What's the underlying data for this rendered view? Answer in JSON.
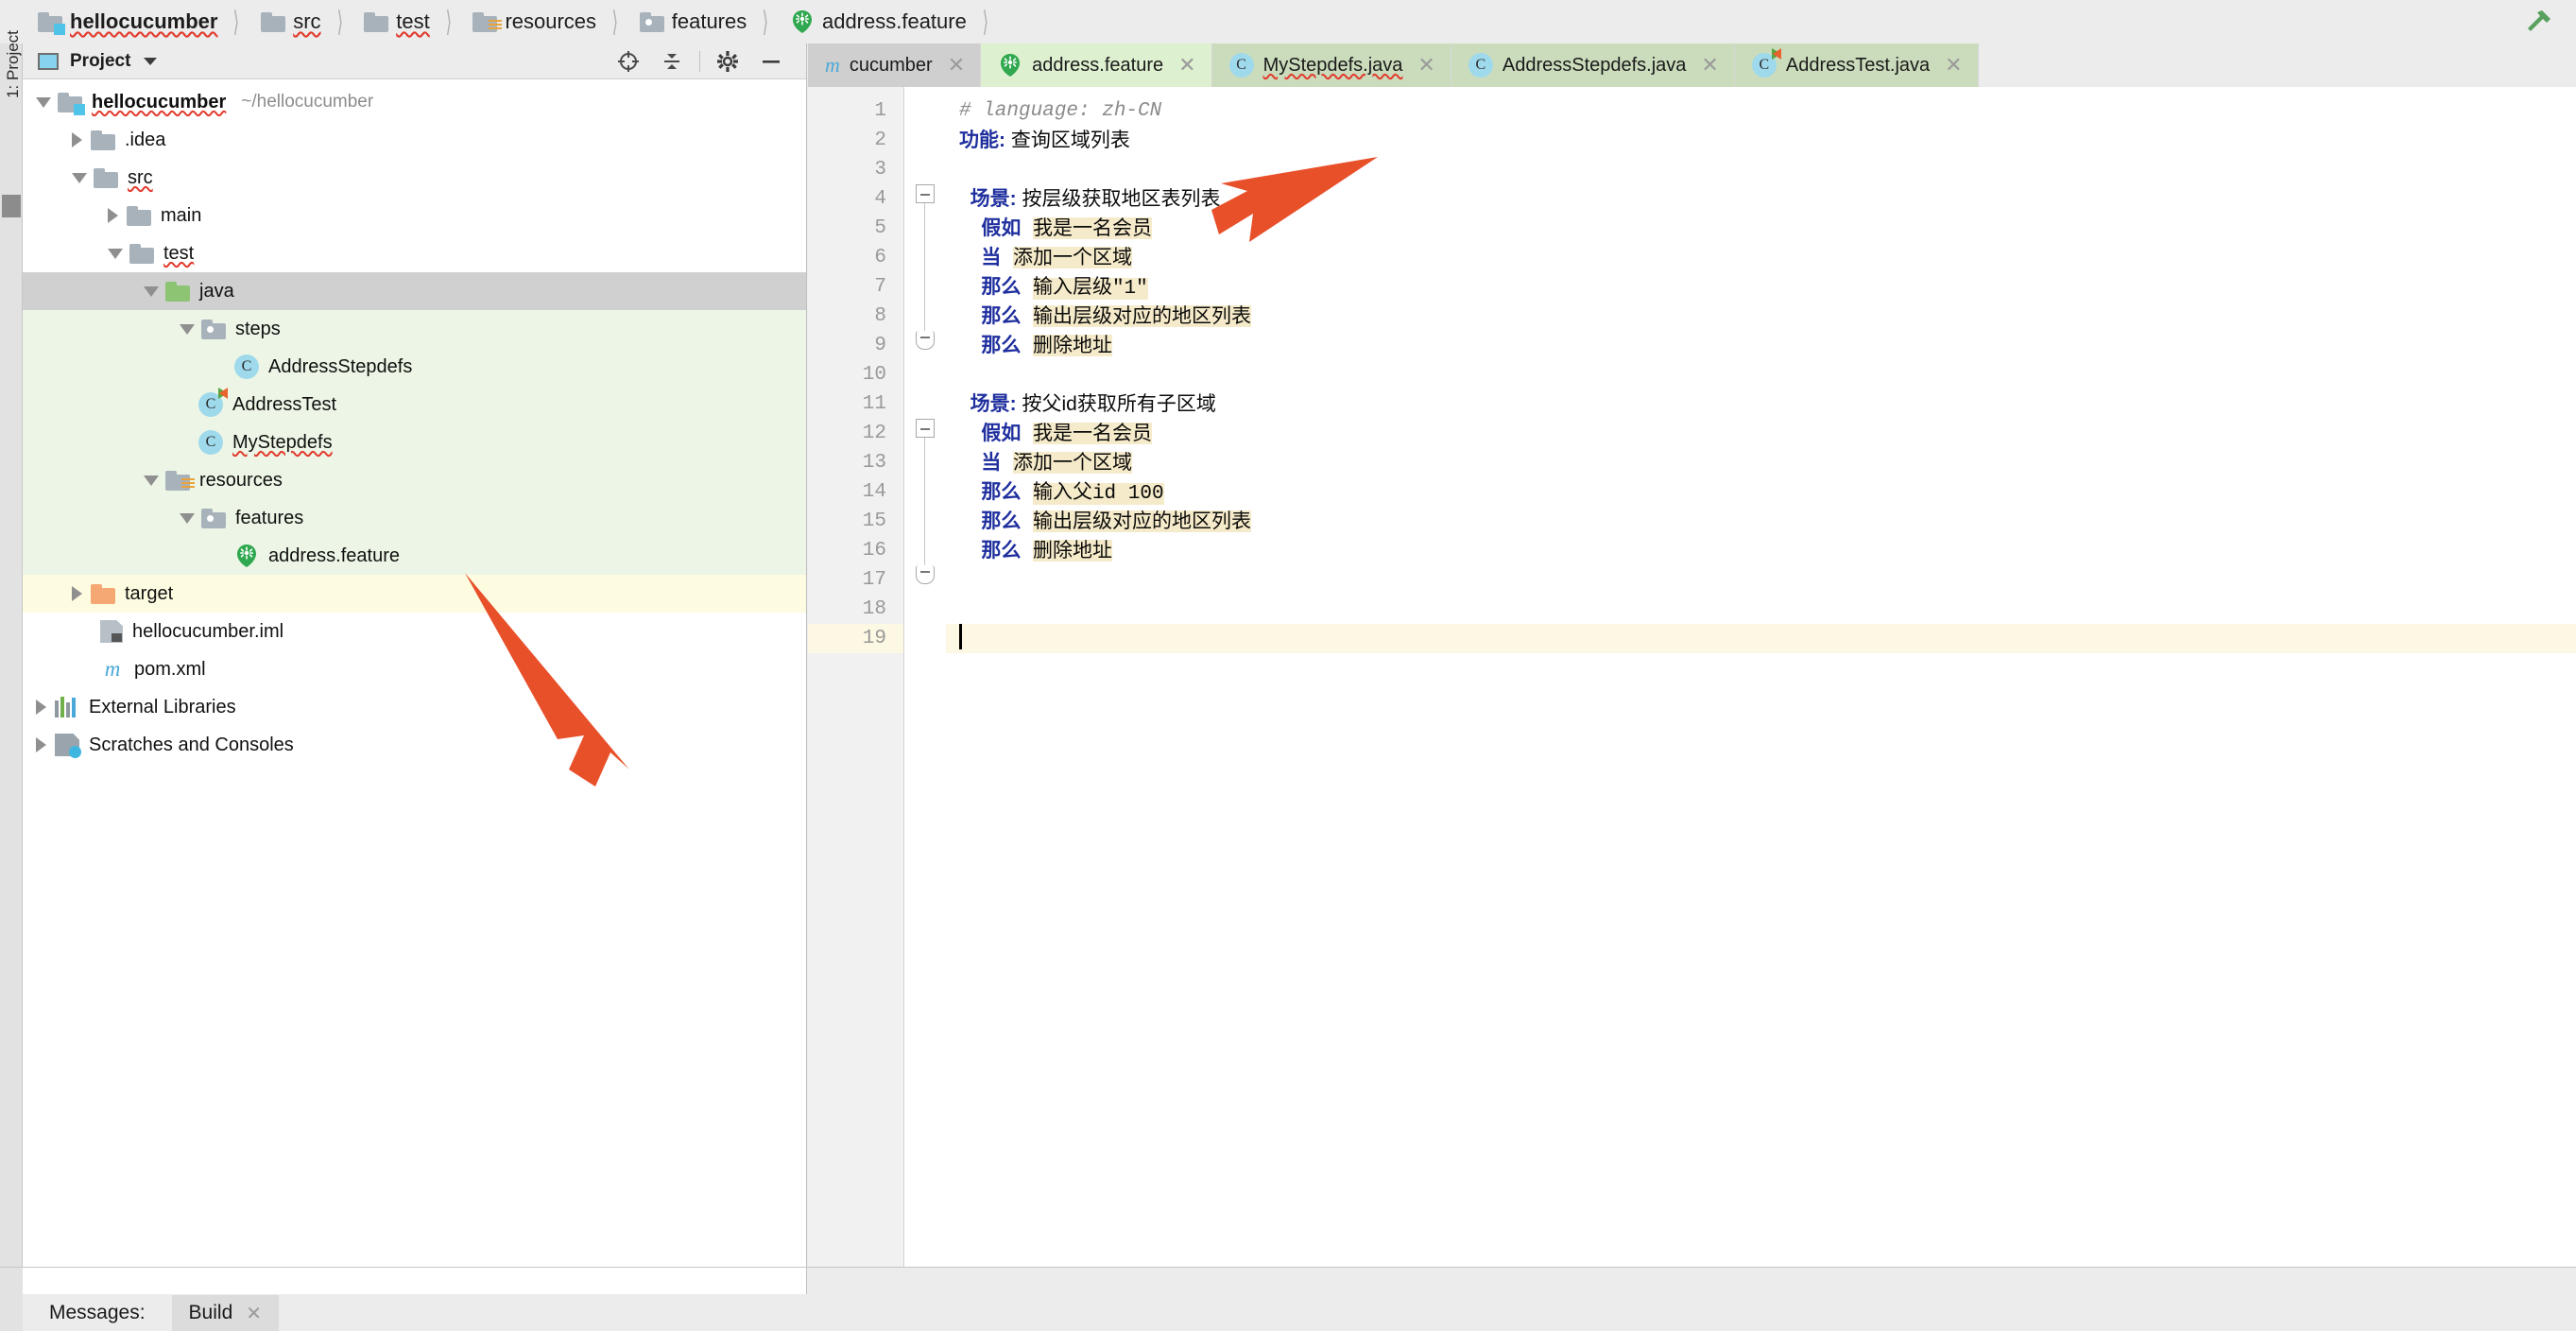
{
  "breadcrumb": {
    "items": [
      {
        "label": "hellocucumber",
        "icon": "module-folder-icon"
      },
      {
        "label": "src",
        "icon": "folder-icon"
      },
      {
        "label": "test",
        "icon": "folder-icon"
      },
      {
        "label": "resources",
        "icon": "resources-folder-icon"
      },
      {
        "label": "features",
        "icon": "package-folder-icon"
      },
      {
        "label": "address.feature",
        "icon": "cucumber-icon"
      }
    ]
  },
  "toolwindow_strip": {
    "project_label": "1: Project"
  },
  "project_panel": {
    "title": "Project",
    "actions": [
      "locate-icon",
      "collapse-all-icon",
      "settings-icon",
      "hide-icon"
    ],
    "tree": [
      {
        "label": "hellocucumber",
        "path": "~/hellocucumber",
        "icon": "module-folder-icon",
        "depth": 0,
        "arrow": "open",
        "bold": true,
        "bg": "none",
        "typo": true
      },
      {
        "label": ".idea",
        "icon": "folder-icon",
        "depth": 1,
        "arrow": "closed",
        "bg": "none"
      },
      {
        "label": "src",
        "icon": "folder-icon",
        "depth": 1,
        "arrow": "open",
        "bg": "none",
        "typo": true
      },
      {
        "label": "main",
        "icon": "folder-icon",
        "depth": 2,
        "arrow": "closed",
        "bg": "none"
      },
      {
        "label": "test",
        "icon": "folder-icon",
        "depth": 2,
        "arrow": "open",
        "bg": "none",
        "typo": true
      },
      {
        "label": "java",
        "icon": "source-folder-icon",
        "depth": 3,
        "arrow": "open",
        "bg": "selected",
        "typo": true
      },
      {
        "label": "steps",
        "icon": "package-folder-icon",
        "depth": 4,
        "arrow": "open",
        "bg": "green"
      },
      {
        "label": "AddressStepdefs",
        "icon": "java-class-icon",
        "depth": 5,
        "arrow": "none",
        "bg": "green"
      },
      {
        "label": "AddressTest",
        "icon": "java-class-runnable-icon",
        "depth": 4,
        "arrow": "none",
        "bg": "green"
      },
      {
        "label": "MyStepdefs",
        "icon": "java-class-icon",
        "depth": 4,
        "arrow": "none",
        "bg": "green",
        "typo": true
      },
      {
        "label": "resources",
        "icon": "resources-folder-icon",
        "depth": 3,
        "arrow": "open",
        "bg": "green"
      },
      {
        "label": "features",
        "icon": "package-folder-icon",
        "depth": 4,
        "arrow": "open",
        "bg": "green"
      },
      {
        "label": "address.feature",
        "icon": "cucumber-icon",
        "depth": 5,
        "arrow": "none",
        "bg": "green"
      },
      {
        "label": "target",
        "icon": "excluded-folder-icon",
        "depth": 1,
        "arrow": "closed",
        "bg": "yellow"
      },
      {
        "label": "hellocucumber.iml",
        "icon": "iml-file-icon",
        "depth": 1,
        "arrow": "none",
        "bg": "none"
      },
      {
        "label": "pom.xml",
        "icon": "maven-icon",
        "depth": 1,
        "arrow": "none",
        "bg": "none"
      },
      {
        "label": "External Libraries",
        "icon": "libraries-icon",
        "depth": 0,
        "arrow": "closed",
        "bg": "none"
      },
      {
        "label": "Scratches and Consoles",
        "icon": "scratches-icon",
        "depth": 0,
        "arrow": "closed",
        "bg": "none"
      }
    ]
  },
  "editor": {
    "tabs": [
      {
        "label": "cucumber",
        "icon": "maven-icon",
        "state": "inactive-gray",
        "closable": true
      },
      {
        "label": "address.feature",
        "icon": "cucumber-icon",
        "state": "active",
        "closable": true
      },
      {
        "label": "MyStepdefs.java",
        "icon": "java-class-icon",
        "state": "green",
        "closable": true,
        "typo": true
      },
      {
        "label": "AddressStepdefs.java",
        "icon": "java-class-icon",
        "state": "green",
        "closable": true
      },
      {
        "label": "AddressTest.java",
        "icon": "java-class-runnable-icon",
        "state": "green",
        "closable": true
      }
    ],
    "line_numbers": [
      "1",
      "2",
      "3",
      "4",
      "5",
      "6",
      "7",
      "8",
      "9",
      "10",
      "11",
      "12",
      "13",
      "14",
      "15",
      "16",
      "17",
      "18",
      "19"
    ],
    "caret_line": 19,
    "lines": [
      {
        "n": 1,
        "segments": [
          {
            "t": "# language: zh-CN",
            "style": "comment"
          }
        ]
      },
      {
        "n": 2,
        "segments": [
          {
            "t": "功能:",
            "style": "keyword"
          },
          {
            "t": " 查询区域列表",
            "style": "plain"
          }
        ]
      },
      {
        "n": 3,
        "segments": []
      },
      {
        "n": 4,
        "segments": [
          {
            "t": "  场景:",
            "style": "keyword"
          },
          {
            "t": " 按层级获取地区表列表",
            "style": "plain"
          }
        ]
      },
      {
        "n": 5,
        "segments": [
          {
            "t": "    假如",
            "style": "keyword"
          },
          {
            "t": " ",
            "style": "plain"
          },
          {
            "t": "我是一名会员",
            "style": "step"
          }
        ]
      },
      {
        "n": 6,
        "segments": [
          {
            "t": "    当",
            "style": "keyword"
          },
          {
            "t": " ",
            "style": "plain"
          },
          {
            "t": "添加一个区域",
            "style": "step"
          }
        ]
      },
      {
        "n": 7,
        "segments": [
          {
            "t": "    那么",
            "style": "keyword"
          },
          {
            "t": " ",
            "style": "plain"
          },
          {
            "t": "输入层级\"1\"",
            "style": "step"
          }
        ]
      },
      {
        "n": 8,
        "segments": [
          {
            "t": "    那么",
            "style": "keyword"
          },
          {
            "t": " ",
            "style": "plain"
          },
          {
            "t": "输出层级对应的地区列表",
            "style": "step"
          }
        ]
      },
      {
        "n": 9,
        "segments": [
          {
            "t": "    那么",
            "style": "keyword"
          },
          {
            "t": " ",
            "style": "plain"
          },
          {
            "t": "删除地址",
            "style": "step"
          }
        ]
      },
      {
        "n": 10,
        "segments": []
      },
      {
        "n": 11,
        "segments": [
          {
            "t": "  场景:",
            "style": "keyword"
          },
          {
            "t": " 按父id获取所有子区域",
            "style": "plain"
          }
        ]
      },
      {
        "n": 12,
        "segments": [
          {
            "t": "    假如",
            "style": "keyword"
          },
          {
            "t": " ",
            "style": "plain"
          },
          {
            "t": "我是一名会员",
            "style": "step"
          }
        ]
      },
      {
        "n": 13,
        "segments": [
          {
            "t": "    当",
            "style": "keyword"
          },
          {
            "t": " ",
            "style": "plain"
          },
          {
            "t": "添加一个区域",
            "style": "step"
          }
        ]
      },
      {
        "n": 14,
        "segments": [
          {
            "t": "    那么",
            "style": "keyword"
          },
          {
            "t": " ",
            "style": "plain"
          },
          {
            "t": "输入父id 100",
            "style": "step"
          }
        ]
      },
      {
        "n": 15,
        "segments": [
          {
            "t": "    那么",
            "style": "keyword"
          },
          {
            "t": " ",
            "style": "plain"
          },
          {
            "t": "输出层级对应的地区列表",
            "style": "step"
          }
        ]
      },
      {
        "n": 16,
        "segments": [
          {
            "t": "    那么",
            "style": "keyword"
          },
          {
            "t": " ",
            "style": "plain"
          },
          {
            "t": "删除地址",
            "style": "step"
          }
        ]
      },
      {
        "n": 17,
        "segments": []
      },
      {
        "n": 18,
        "segments": []
      },
      {
        "n": 19,
        "segments": []
      }
    ]
  },
  "bottom_bar": {
    "messages_label": "Messages:",
    "build_tab": "Build"
  },
  "annotations": {
    "arrow_color": "#e8502a",
    "arrow_count": 2
  },
  "colors": {
    "keyword": "#1f2f9e",
    "step_highlight": "#f5eac9",
    "selection": "#d0d0d0",
    "green_row": "#edf6e6",
    "yellow_row": "#fdfbe0",
    "active_tab": "#ddf0cf",
    "cucumber_green": "#2fa84f",
    "accent_blue": "#4aa8d8"
  }
}
